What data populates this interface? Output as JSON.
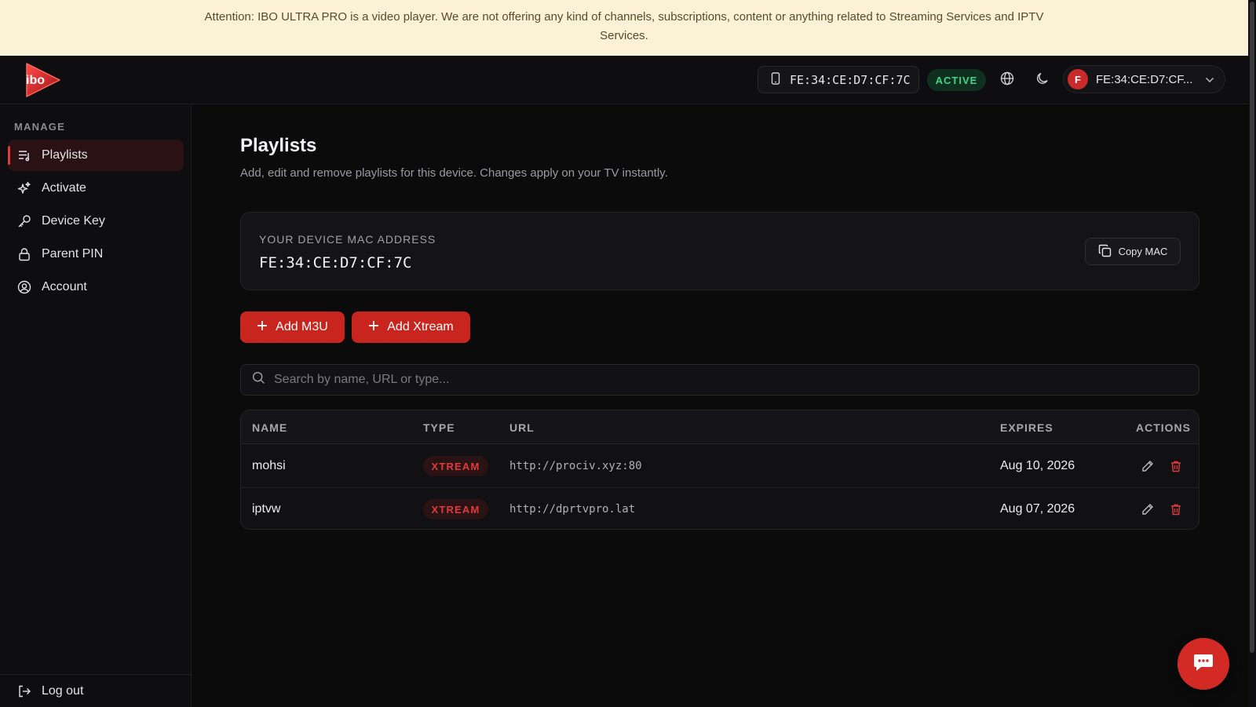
{
  "banner": {
    "text": "Attention: IBO ULTRA PRO is a video player. We are not offering any kind of channels, subscriptions, content or anything related to Streaming Services and IPTV Services."
  },
  "header": {
    "logo_text": "ibo",
    "device_mac": "FE:34:CE:D7:CF:7C",
    "status": "ACTIVE",
    "user_initial": "F",
    "user_label": "FE:34:CE:D7:CF..."
  },
  "sidebar": {
    "section": "MANAGE",
    "items": [
      {
        "label": "Playlists",
        "icon": "playlist-icon",
        "active": true
      },
      {
        "label": "Activate",
        "icon": "sparkles-icon"
      },
      {
        "label": "Device Key",
        "icon": "key-icon"
      },
      {
        "label": "Parent PIN",
        "icon": "lock-icon"
      },
      {
        "label": "Account",
        "icon": "user-circle-icon"
      }
    ],
    "logout": "Log out"
  },
  "main": {
    "title": "Playlists",
    "subtitle": "Add, edit and remove playlists for this device. Changes apply on your TV instantly.",
    "mac_card": {
      "label": "YOUR DEVICE MAC ADDRESS",
      "value": "FE:34:CE:D7:CF:7C",
      "copy_label": "Copy MAC"
    },
    "add_m3u": "Add M3U",
    "add_xtream": "Add Xtream",
    "search_placeholder": "Search by name, URL or type...",
    "table": {
      "headers": {
        "name": "NAME",
        "type": "TYPE",
        "url": "URL",
        "expires": "EXPIRES",
        "actions": "ACTIONS"
      },
      "rows": [
        {
          "name": "mohsi",
          "type": "XTREAM",
          "url": "http://prociv.xyz:80",
          "expires": "Aug 10, 2026"
        },
        {
          "name": "iptvw",
          "type": "XTREAM",
          "url": "http://dprtvpro.lat",
          "expires": "Aug 07, 2026"
        }
      ]
    }
  },
  "colors": {
    "accent": "#c8251f",
    "active_green": "#3ed58b",
    "banner_bg": "#fbf1d6"
  }
}
